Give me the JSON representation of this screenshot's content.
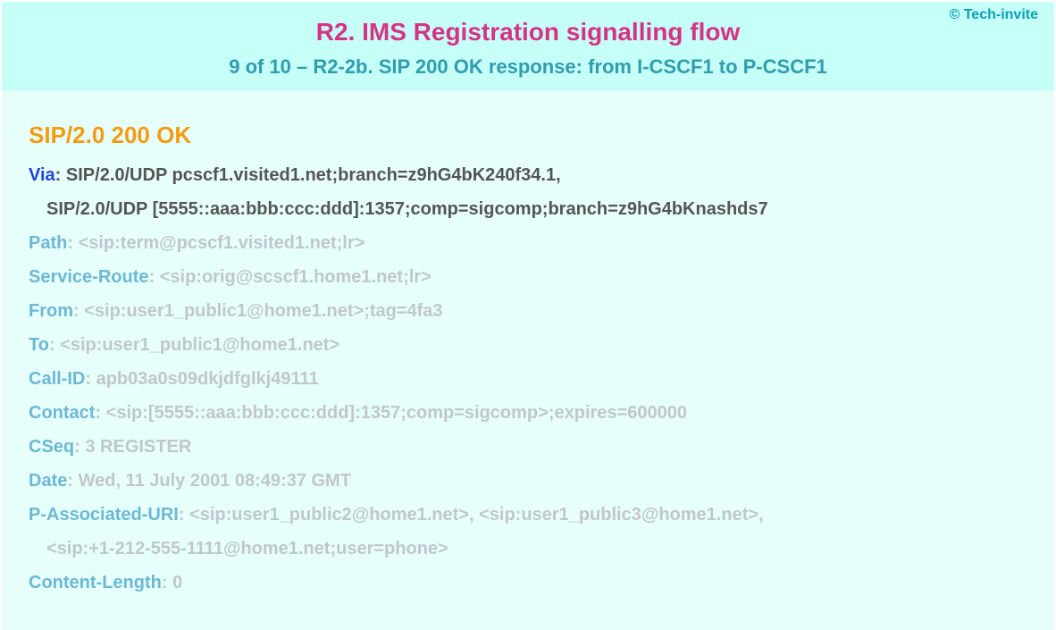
{
  "header": {
    "copyright": "© Tech-invite",
    "title": "R2. IMS Registration signalling flow",
    "subtitle": "9 of 10 – R2-2b. SIP 200 OK response: from I-CSCF1 to P-CSCF1"
  },
  "sip": {
    "status_line": "SIP/2.0 200 OK",
    "via": {
      "key": "Via",
      "line1": " SIP/2.0/UDP pcscf1.visited1.net;branch=z9hG4bK240f34.1,",
      "line2": "SIP/2.0/UDP [5555::aaa:bbb:ccc:ddd]:1357;comp=sigcomp;branch=z9hG4bKnashds7"
    },
    "path": {
      "key": "Path",
      "val": " <sip:term@pcscf1.visited1.net;lr>"
    },
    "service_route": {
      "key": "Service-Route",
      "val": " <sip:orig@scscf1.home1.net;lr>"
    },
    "from": {
      "key": "From",
      "val": " <sip:user1_public1@home1.net>;tag=4fa3"
    },
    "to": {
      "key": "To",
      "val": " <sip:user1_public1@home1.net>"
    },
    "call_id": {
      "key": "Call-ID",
      "val": " apb03a0s09dkjdfglkj49111"
    },
    "contact": {
      "key": "Contact",
      "val": " <sip:[5555::aaa:bbb:ccc:ddd]:1357;comp=sigcomp>;expires=600000"
    },
    "cseq": {
      "key": "CSeq",
      "val": " 3 REGISTER"
    },
    "date": {
      "key": "Date",
      "val": " Wed, 11 July 2001 08:49:37 GMT"
    },
    "pau": {
      "key": "P-Associated-URI",
      "line1": " <sip:user1_public2@home1.net>, <sip:user1_public3@home1.net>,",
      "line2": "<sip:+1-212-555-1111@home1.net;user=phone>"
    },
    "content_length": {
      "key": "Content-Length",
      "val": " 0"
    }
  }
}
